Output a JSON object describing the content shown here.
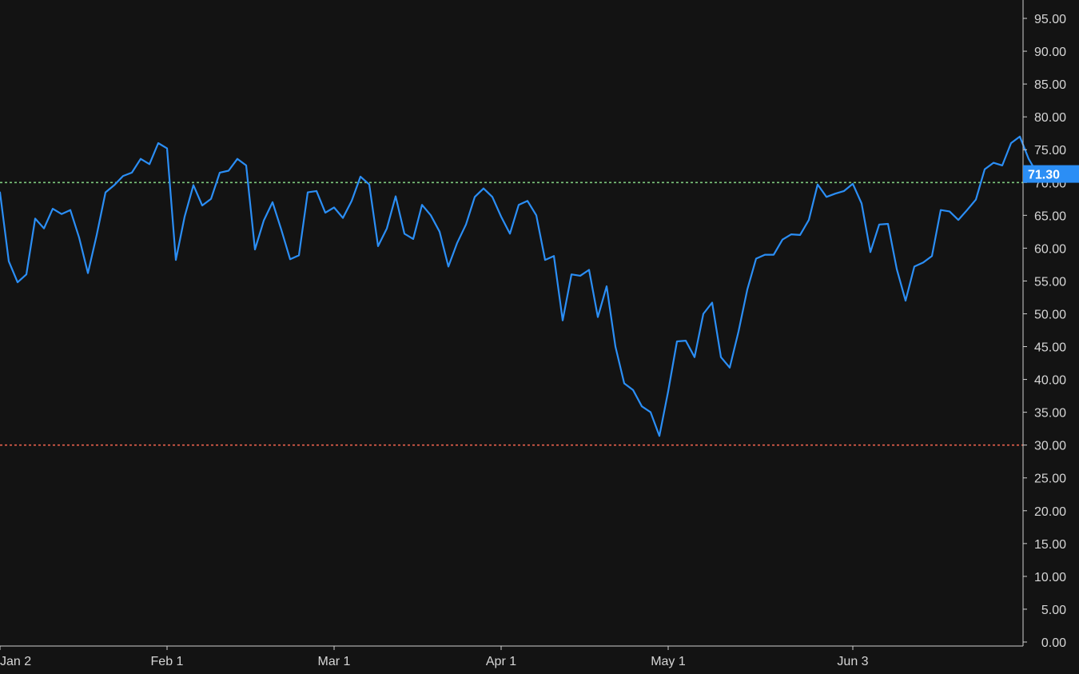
{
  "chart_data": {
    "type": "line",
    "series": [
      {
        "values": [
          68.5,
          58.0,
          54.8,
          56.0,
          64.5,
          63.0,
          66.0,
          65.2,
          65.8,
          61.6,
          56.2,
          62.0,
          68.5,
          69.6,
          71.0,
          71.5,
          73.6,
          72.8,
          76.0,
          75.2,
          58.2,
          64.8,
          69.6,
          66.5,
          67.5,
          71.5,
          71.8,
          73.6,
          72.6,
          59.8,
          64.2,
          67.0,
          62.8,
          58.3,
          58.9,
          68.5,
          68.7,
          65.4,
          66.2,
          64.6,
          67.2,
          70.9,
          69.7,
          60.3,
          63.0,
          67.9,
          62.2,
          61.4,
          66.6,
          65.0,
          62.5,
          57.2,
          60.8,
          63.6,
          67.8,
          69.1,
          67.8,
          64.8,
          62.2,
          66.6,
          67.2,
          65.0,
          58.2,
          58.8,
          49.0,
          56.0,
          55.8,
          56.7,
          49.5,
          54.2,
          45.0,
          39.4,
          38.4,
          35.9,
          35.0,
          31.4,
          38.2,
          45.8,
          45.9,
          43.4,
          50.0,
          51.7,
          43.4,
          41.8,
          47.3,
          53.7,
          58.4,
          59.0,
          59.0,
          61.3,
          62.1,
          62.0,
          64.3,
          69.7,
          67.8,
          68.3,
          68.7,
          69.8,
          66.8,
          59.4,
          63.6,
          63.7,
          56.8,
          52.0,
          57.2,
          57.8,
          58.8,
          65.8,
          65.6,
          64.3,
          65.8,
          67.4,
          72.0,
          73.0,
          72.6,
          76.0,
          77.0,
          73.6,
          71.3
        ]
      }
    ],
    "x_tick_labels": [
      "Jan 2",
      "Feb 1",
      "Mar 1",
      "Apr 1",
      "May 1",
      "Jun 3"
    ],
    "x_tick_indices": [
      0,
      19,
      38,
      57,
      76,
      97
    ],
    "y_tick_labels": [
      "0.00",
      "5.00",
      "10.00",
      "15.00",
      "20.00",
      "25.00",
      "30.00",
      "35.00",
      "40.00",
      "45.00",
      "50.00",
      "55.00",
      "60.00",
      "65.00",
      "70.00",
      "75.00",
      "80.00",
      "85.00",
      "90.00",
      "95.00"
    ],
    "ylim": [
      0,
      95
    ],
    "reference_lines": [
      {
        "value": 70,
        "color": "#7ec97e"
      },
      {
        "value": 30,
        "color": "#e8604c"
      }
    ],
    "last_value_label": "71.30",
    "colors": {
      "background": "#131313",
      "line": "#2b8ef5",
      "axis": "#d6d6d6",
      "last_value_bg": "#2b8ef5"
    },
    "grid": false,
    "legend": "none"
  }
}
